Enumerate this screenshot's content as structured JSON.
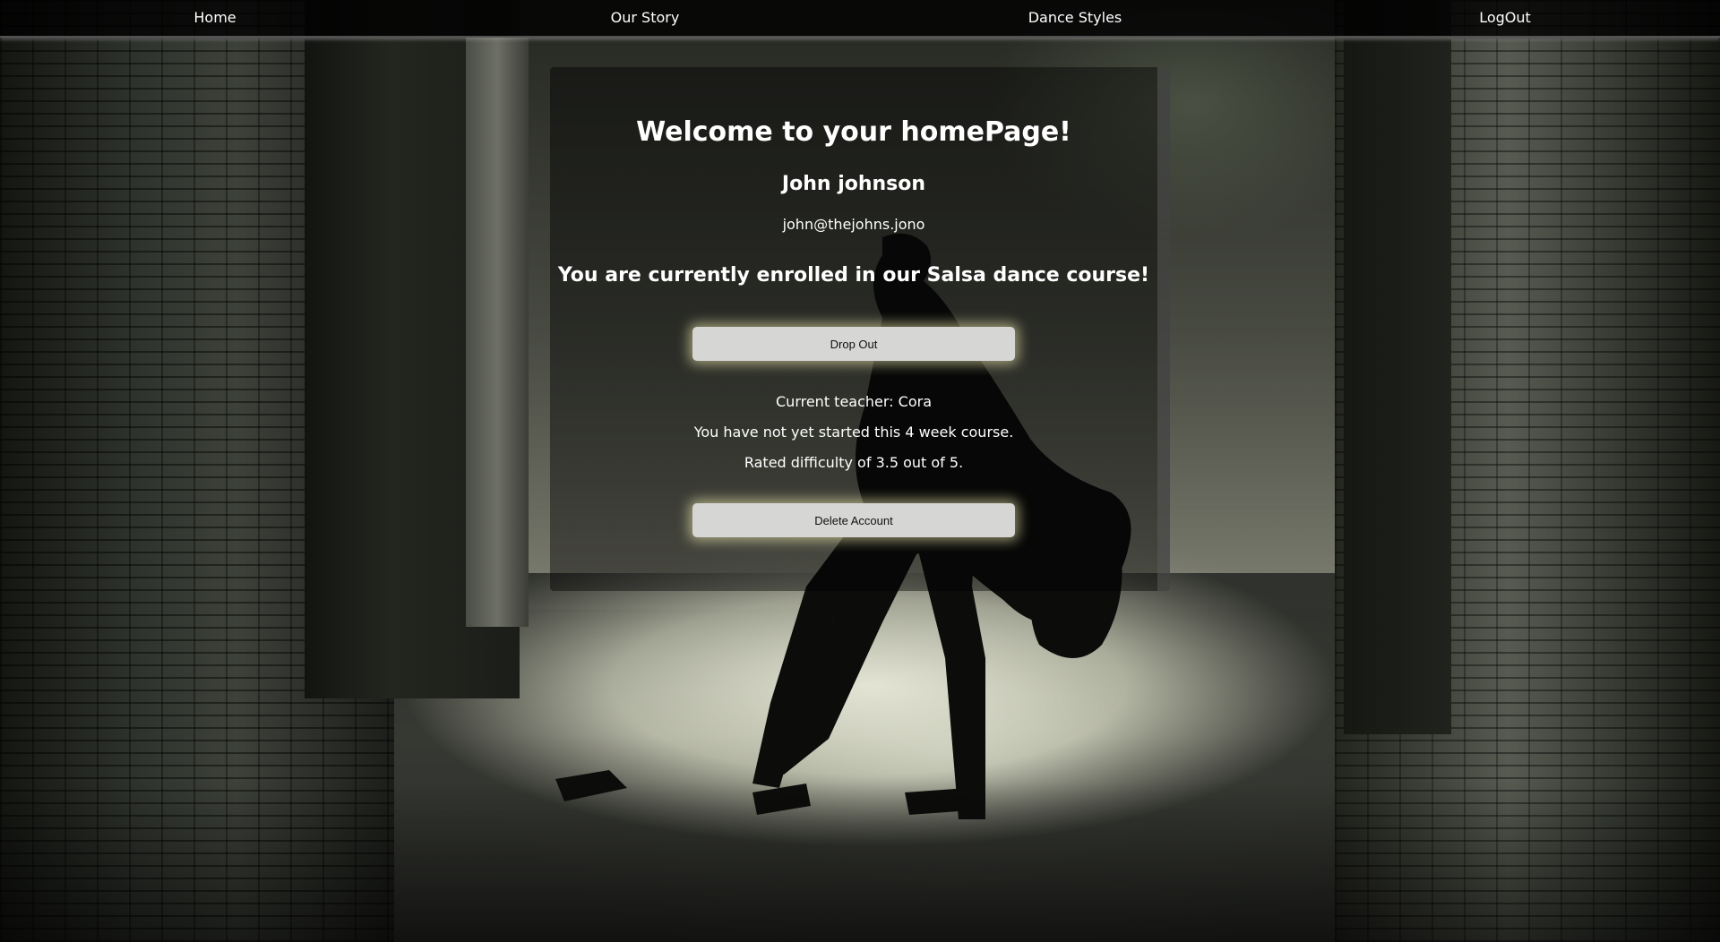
{
  "nav": {
    "items": [
      {
        "label": "Home"
      },
      {
        "label": "Our Story"
      },
      {
        "label": "Dance Styles"
      },
      {
        "label": "LogOut"
      }
    ]
  },
  "card": {
    "title": "Welcome to your homePage!",
    "user_name": "John johnson",
    "user_email": "john@thejohns.jono",
    "enrollment_message": "You are currently enrolled in our Salsa dance course!",
    "drop_out_label": "Drop Out",
    "teacher_line": "Current teacher: Cora",
    "progress_line": "You have not yet started this 4 week course.",
    "difficulty_line": "Rated difficulty of 3.5 out of 5.",
    "delete_account_label": "Delete Account"
  },
  "colors": {
    "button_bg": "#d6d6d4",
    "button_glow": "#fffcbe",
    "nav_bg": "#000000",
    "text": "#ffffff"
  }
}
